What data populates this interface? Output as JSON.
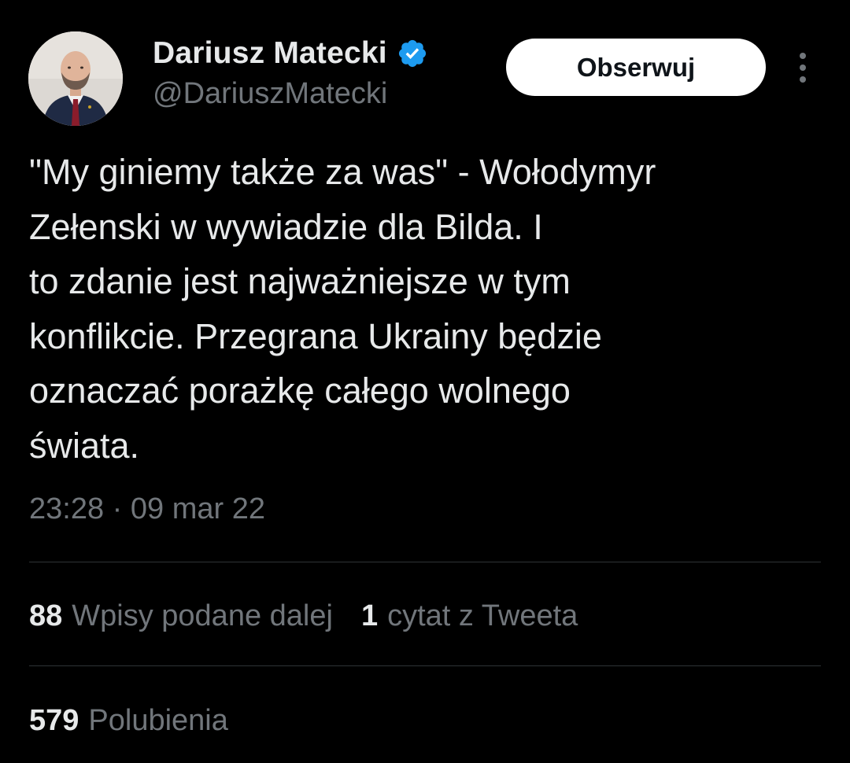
{
  "author": {
    "display_name": "Dariusz Matecki",
    "handle": "@DariuszMatecki",
    "verified_icon": "verified-badge-icon",
    "avatar": "profile-photo",
    "verified_color": "#1d9bf0"
  },
  "actions": {
    "follow_label": "Obserwuj",
    "more_icon": "more-vertical-icon"
  },
  "tweet": {
    "lines": [
      "\"My giniemy także za was\" - Wołodymyr",
      "Zełenski w wywiadzie dla Bilda. I",
      "to zdanie jest najważniejsze w tym",
      "konflikcie. Przegrana Ukrainy będzie",
      "oznaczać porażkę całego wolnego",
      "świata."
    ],
    "timestamp": "23:28 · 09 mar 22"
  },
  "stats": {
    "retweets": {
      "count": "88",
      "label": "Wpisy podane dalej"
    },
    "quotes": {
      "count": "1",
      "label": "cytat z Tweeta"
    },
    "likes": {
      "count": "579",
      "label": "Polubienia"
    }
  },
  "colors": {
    "background": "#000000",
    "text_primary": "#e7e9ea",
    "text_secondary": "#71767b",
    "divider": "#2f3336",
    "button_bg": "#ffffff"
  }
}
